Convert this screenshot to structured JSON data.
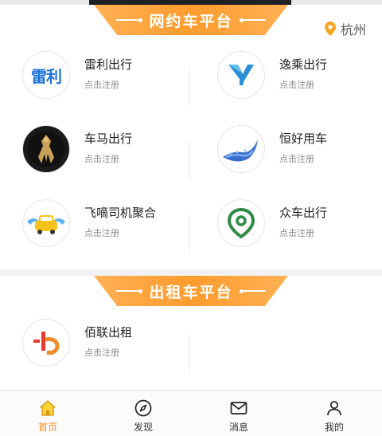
{
  "ride_hailing": {
    "title": "网约车平台",
    "city": "杭州",
    "platforms": [
      {
        "name": "雷利出行",
        "action": "点击注册",
        "logo_text": "雷利",
        "icon": "leili-logo-icon"
      },
      {
        "name": "逸乘出行",
        "action": "点击注册",
        "icon": "yicheng-logo-icon"
      },
      {
        "name": "车马出行",
        "action": "点击注册",
        "icon": "chema-logo-icon"
      },
      {
        "name": "恒好用车",
        "action": "点击注册",
        "icon": "henghao-logo-icon"
      },
      {
        "name": "飞嘀司机聚合",
        "action": "点击注册",
        "icon": "feidi-logo-icon"
      },
      {
        "name": "众车出行",
        "action": "点击注册",
        "icon": "zhongche-logo-icon"
      }
    ]
  },
  "taxi": {
    "title": "出租车平台",
    "platforms": [
      {
        "name": "佰联出租",
        "action": "点击注册",
        "icon": "bailian-logo-icon"
      }
    ]
  },
  "tabbar": {
    "items": [
      {
        "label": "首页",
        "icon": "home-icon",
        "active": true
      },
      {
        "label": "发现",
        "icon": "compass-icon",
        "active": false
      },
      {
        "label": "消息",
        "icon": "mail-icon",
        "active": false
      },
      {
        "label": "我的",
        "icon": "user-icon",
        "active": false
      }
    ]
  },
  "colors": {
    "accent": "#ff8a1c",
    "banner": "#ff9c2e",
    "pin": "#f5a623"
  }
}
